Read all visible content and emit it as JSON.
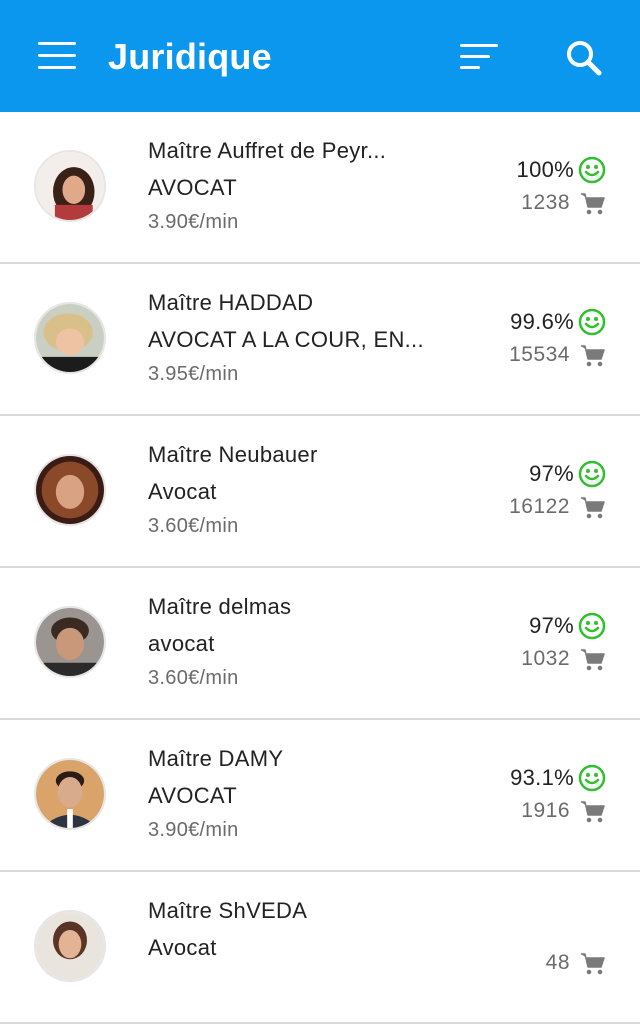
{
  "app": {
    "title": "Juridique"
  },
  "toolbar": {
    "menu_icon": "hamburger-menu-icon",
    "sort_icon": "sort-filter-icon",
    "search_icon": "search-icon"
  },
  "colors": {
    "appbar": "#0b97ee",
    "smile": "#2fbf2f",
    "cart": "#7a7a7a",
    "divider": "#d9d9d9"
  },
  "lawyers": [
    {
      "name": "Maître Auffret de Peyr...",
      "specialty": "AVOCAT",
      "price": "3.90€/min",
      "rating": "100%",
      "consultations": "1238"
    },
    {
      "name": "Maître HADDAD",
      "specialty": "AVOCAT A LA COUR, EN...",
      "price": "3.95€/min",
      "rating": "99.6%",
      "consultations": "15534"
    },
    {
      "name": "Maître Neubauer",
      "specialty": "Avocat",
      "price": "3.60€/min",
      "rating": "97%",
      "consultations": "16122"
    },
    {
      "name": "Maître delmas",
      "specialty": "avocat",
      "price": "3.60€/min",
      "rating": "97%",
      "consultations": "1032"
    },
    {
      "name": "Maître DAMY",
      "specialty": "AVOCAT",
      "price": "3.90€/min",
      "rating": "93.1%",
      "consultations": "1916"
    },
    {
      "name": "Maître ShVEDA",
      "specialty": "Avocat",
      "price": "",
      "rating": "",
      "consultations": "48"
    }
  ]
}
